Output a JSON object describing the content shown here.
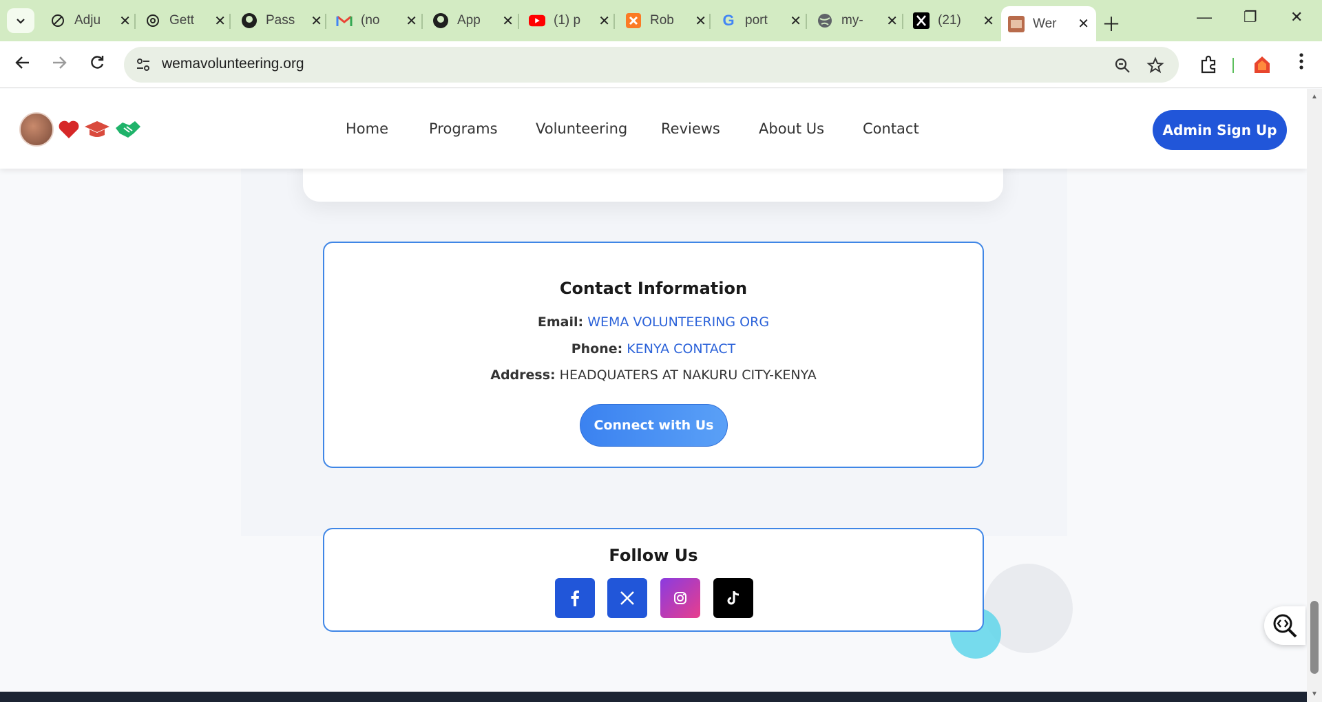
{
  "browser": {
    "tabs": [
      {
        "title": "Adju",
        "icon": "chatgpt-icon"
      },
      {
        "title": "Gett",
        "icon": "openai-icon"
      },
      {
        "title": "Pass",
        "icon": "github-icon"
      },
      {
        "title": "(no",
        "icon": "gmail-icon"
      },
      {
        "title": "App",
        "icon": "github-icon"
      },
      {
        "title": "(1) p",
        "icon": "youtube-icon"
      },
      {
        "title": "Rob",
        "icon": "xampp-icon"
      },
      {
        "title": "port",
        "icon": "google-icon"
      },
      {
        "title": "my-",
        "icon": "globe-icon"
      },
      {
        "title": "(21)",
        "icon": "x-icon"
      },
      {
        "title": "Wer",
        "icon": "site-favicon"
      }
    ],
    "url": "wemavolunteering.org"
  },
  "site": {
    "nav": [
      "Home",
      "Programs",
      "Volunteering",
      "Reviews",
      "About Us",
      "Contact"
    ],
    "admin_button": "Admin Sign Up"
  },
  "contact": {
    "title": "Contact Information",
    "email_label": "Email:",
    "email_value": "WEMA VOLUNTEERING ORG",
    "phone_label": "Phone:",
    "phone_value": "KENYA CONTACT",
    "address_label": "Address:",
    "address_value": "HEADQUATERS AT NAKURU CITY-KENYA",
    "button": "Connect with Us"
  },
  "follow": {
    "title": "Follow Us",
    "socials": [
      {
        "name": "facebook",
        "glyph": "f",
        "color": "#2156d9"
      },
      {
        "name": "x",
        "glyph": "𝕏",
        "color": "#2156d9"
      },
      {
        "name": "instagram",
        "glyph": "◎",
        "color": "#c13fd8"
      },
      {
        "name": "tiktok",
        "glyph": "♪",
        "color": "#000000"
      }
    ]
  },
  "colors": {
    "accent": "#2156d9",
    "card_border": "#3f86e6",
    "link": "#2b62d9",
    "tab_bar": "#d3ebc3"
  }
}
